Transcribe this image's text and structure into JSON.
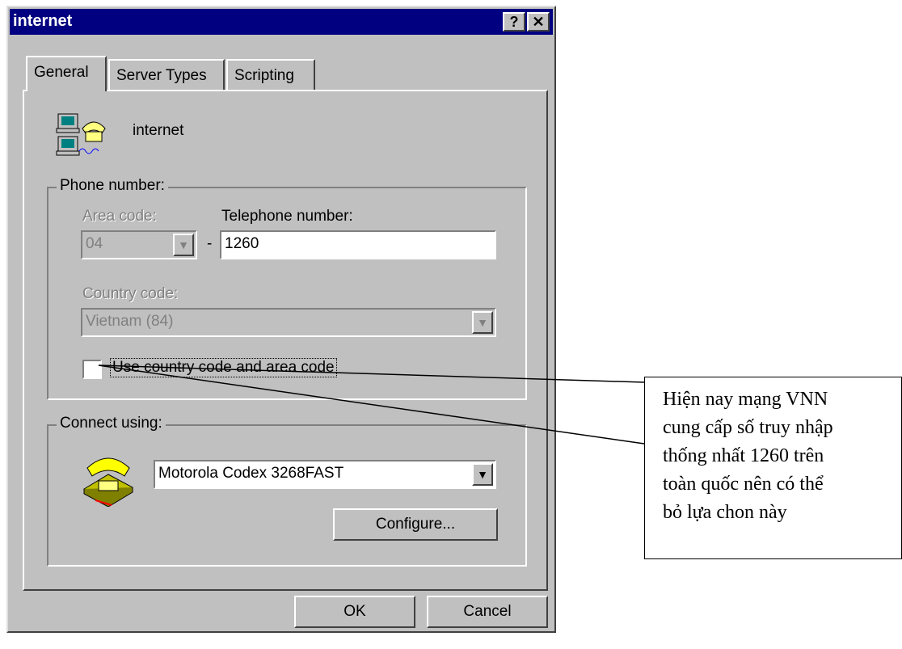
{
  "window": {
    "title": "internet",
    "help_glyph": "?",
    "close_glyph": "✕"
  },
  "tabs": [
    {
      "label": "General",
      "active": true
    },
    {
      "label": "Server Types",
      "active": false
    },
    {
      "label": "Scripting",
      "active": false
    }
  ],
  "connection": {
    "name": "internet",
    "icon": "dialup-network-icon"
  },
  "phone": {
    "group_label": "Phone number:",
    "area_code_label": "Area code:",
    "area_code_value": "04",
    "dash": "-",
    "telephone_label": "Telephone number:",
    "telephone_value": "1260",
    "country_code_label": "Country code:",
    "country_code_value": "Vietnam (84)",
    "use_codes_label": "Use country code and area code",
    "use_codes_checked": false
  },
  "connect": {
    "group_label": "Connect using:",
    "modem_value": "Motorola Codex 3268FAST",
    "modem_icon": "modem-telephone-icon",
    "configure_label": "Configure..."
  },
  "buttons": {
    "ok_label": "OK",
    "cancel_label": "Cancel"
  },
  "callout": {
    "lines": [
      "Hiện nay mạng VNN",
      "cung cấp số truy nhập",
      "thống nhất 1260 trên",
      "toàn quốc nên có thể",
      "bỏ lựa chon này"
    ]
  },
  "colors": {
    "title_bar": "#000080",
    "face": "#c0c0c0"
  }
}
